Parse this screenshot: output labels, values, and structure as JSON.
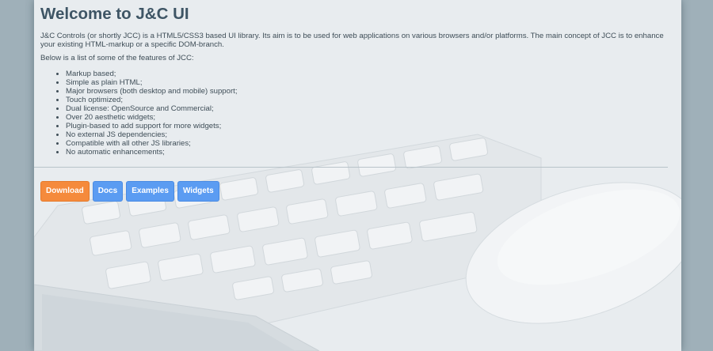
{
  "header": {
    "title": "Welcome to J&C UI"
  },
  "intro": {
    "paragraph": "J&C Controls (or shortly JCC) is a HTML5/CSS3 based UI library. Its aim is to be used for web applications on various browsers and/or platforms. The main concept of JCC is to enhance your existing HTML-markup or a specific DOM-branch.",
    "features_lead": "Below is a list of some of the features of JCC:"
  },
  "features": [
    "Markup based;",
    "Simple as plain HTML;",
    "Major browsers (both desktop and mobile) support;",
    "Touch optimized;",
    "Dual license: OpenSource and Commercial;",
    "Over 20 aesthetic widgets;",
    "Plugin-based to add support for more widgets;",
    "No external JS dependencies;",
    "Compatible with all other JS libraries;",
    "No automatic enhancements;"
  ],
  "buttons": {
    "download": "Download",
    "docs": "Docs",
    "examples": "Examples",
    "widgets": "Widgets"
  },
  "colors": {
    "page_bg": "#e8ecef",
    "outer_bg": "#9fb0b9",
    "title": "#3e5565",
    "download_button": "#f58a3c",
    "nav_button": "#5b9cf2"
  }
}
